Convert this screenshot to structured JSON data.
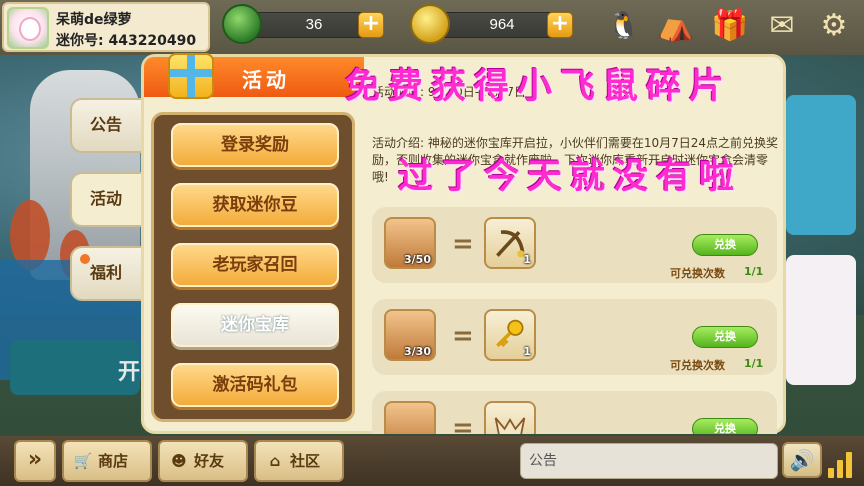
{
  "profile": {
    "name": "呆萌de绿萝",
    "id_text": "迷你号: 443220490"
  },
  "currency": {
    "green_amount": "36",
    "gold_amount": "964"
  },
  "top_icons": [
    "penguin-icon",
    "tent-icon",
    "gift-box-icon",
    "mail-icon",
    "gear-icon"
  ],
  "side_tabs": [
    "公告",
    "活动",
    "福利"
  ],
  "panel": {
    "title": "活动",
    "menu": [
      "登录奖励",
      "获取迷你豆",
      "老玩家召回",
      "迷你宝库",
      "激活码礼包"
    ],
    "time_text": "活动时间: 9月30日-10月7日",
    "description": "活动介绍: 神秘的迷你宝库开启拉，小伙伴们需要在10月7日24点之前兑换奖励，否则收集的迷你宝盒就作废啦，下次迷你库重新开启时迷你宝盒会清零哦!",
    "rows": [
      {
        "chest_count": "3/50",
        "reward_count": "1",
        "reward_icon": "crossbow-icon",
        "button": "兑换",
        "limit_label": "可兑换次数",
        "limit_value": "1/1"
      },
      {
        "chest_count": "3/30",
        "reward_count": "1",
        "reward_icon": "key-icon",
        "button": "兑换",
        "limit_label": "可兑换次数",
        "limit_value": "1/1"
      },
      {
        "chest_count": "",
        "reward_count": "",
        "reward_icon": "mask-icon",
        "button": "兑换",
        "limit_label": "",
        "limit_value": ""
      }
    ]
  },
  "overlay": {
    "line1": "免费获得小飞鼠碎片",
    "line2": "过了今天就没有啦"
  },
  "bottom": {
    "shop": "商店",
    "friends": "好友",
    "community": "社区",
    "notice": "公告"
  },
  "background": {
    "left_card_text": "开"
  },
  "colors": {
    "accent_orange": "#ee5a12",
    "overlay_pink": "#ff2bd0",
    "button_green": "#55b41e"
  }
}
